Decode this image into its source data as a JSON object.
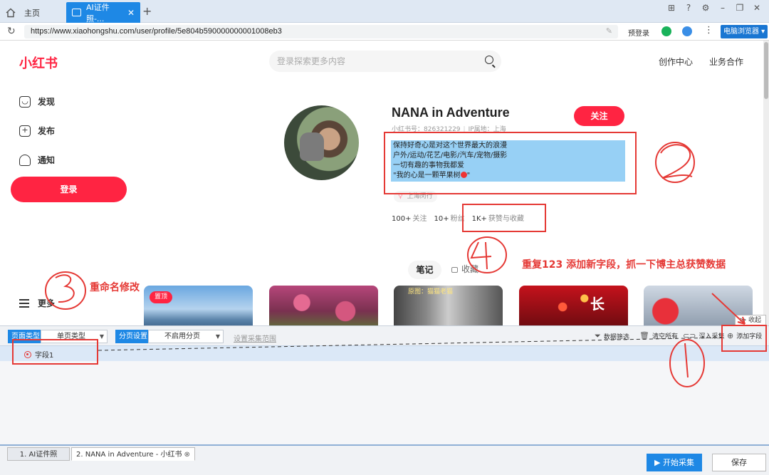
{
  "browser": {
    "tabs": [
      {
        "label": "主页",
        "icon": "home-icon"
      },
      {
        "label": "AI证件照-...",
        "icon": "page-icon"
      }
    ],
    "url": "https://www.xiaohongshu.com/user/profile/5e804b590000000001008eb3",
    "prelogin": "预登录",
    "mode_button": "电脑浏览器"
  },
  "site": {
    "logo": "小红书",
    "search_placeholder": "登录探索更多内容",
    "nav_right": [
      "创作中心",
      "业务合作"
    ],
    "sidebar": {
      "items": [
        "发现",
        "发布",
        "通知"
      ],
      "login": "登录",
      "more": "更多"
    },
    "profile": {
      "name": "NANA in Adventure",
      "follow": "关注",
      "redbook_id": "小红书号：826321229",
      "ip": "IP属地：上海",
      "bio": [
        "保持好奇心是对这个世界最大的浪漫",
        "户外/运动/花艺/电影/汽车/宠物/摄影",
        "一切有趣的事物我都爱",
        "\"我的心是一颗苹果树",
        "\""
      ],
      "location": "上海闵行",
      "stats": [
        {
          "value": "100+",
          "label": "关注"
        },
        {
          "value": "10+",
          "label": "粉丝"
        },
        {
          "value": "1K+",
          "label": "获赞与收藏"
        }
      ]
    },
    "tabs": {
      "notes": "笔记",
      "collect": "收藏"
    },
    "cards": {
      "pinned": "置顶",
      "card3_caption": "原图：猫猫老猫",
      "card4_text": "长"
    }
  },
  "scraper": {
    "collapse": "收起",
    "page_type_label": "页面类型",
    "page_type_value": "单页类型",
    "paging_label": "分页设置",
    "paging_value": "不启用分页",
    "range_link": "设置采集范围",
    "tools": [
      "数据筛选",
      "清空所有",
      "深入采集",
      "添加字段"
    ],
    "field": "字段1"
  },
  "bottom": {
    "tabs": [
      "1. AI证件照",
      "2. NANA in Adventure - 小红书"
    ],
    "start": "开始采集",
    "save": "保存"
  },
  "annotations": {
    "rename": "重命名修改",
    "repeat": "重复123 添加新字段，抓一下博主总获赞数据"
  },
  "colors": {
    "brand": "#ff2442",
    "accent": "#1e88e5",
    "annotation": "#e53935"
  }
}
